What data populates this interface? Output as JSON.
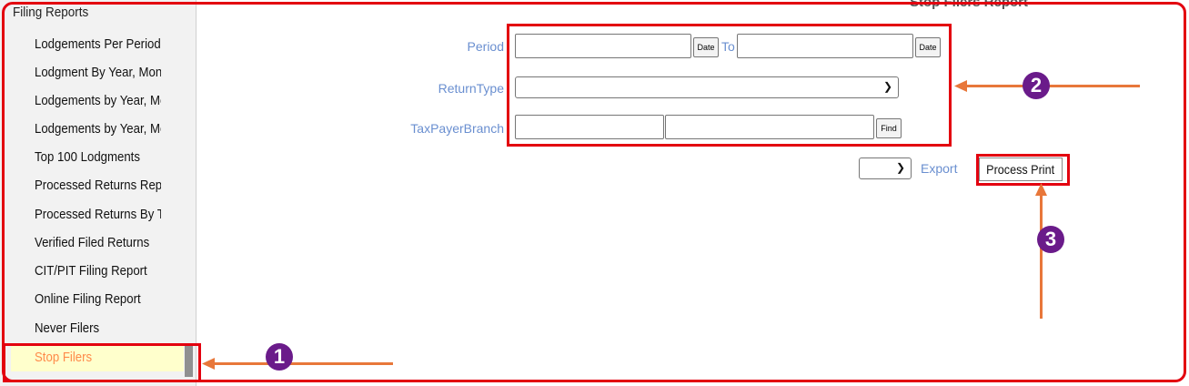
{
  "sidebar": {
    "title": "Filing Reports",
    "items": [
      {
        "label": "Lodgements Per Period"
      },
      {
        "label": "Lodgment By Year, Month and"
      },
      {
        "label": "Lodgements by Year, Month"
      },
      {
        "label": "Lodgements by Year, Month"
      },
      {
        "label": "Top 100 Lodgments"
      },
      {
        "label": "Processed Returns Report"
      },
      {
        "label": "Processed Returns By Tax"
      },
      {
        "label": "Verified Filed Returns"
      },
      {
        "label": "CIT/PIT Filing Report"
      },
      {
        "label": "Online Filing Report"
      },
      {
        "label": "Never Filers"
      }
    ],
    "active_item": "Stop Filers"
  },
  "report": {
    "title": "Stop Filers Report",
    "period_label": "Period",
    "date_button": "Date",
    "to_label": "To",
    "return_type_label": "ReturnType",
    "taxpayer_branch_label": "TaxPayerBranch",
    "find_button": "Find",
    "export_label": "Export",
    "process_print_button": "Process Print"
  },
  "annotations": {
    "badge_1": "1",
    "badge_2": "2",
    "badge_3": "3",
    "highlight_color": "#e3000f",
    "arrow_color": "#e8773a",
    "badge_color": "#6a1b8a"
  }
}
